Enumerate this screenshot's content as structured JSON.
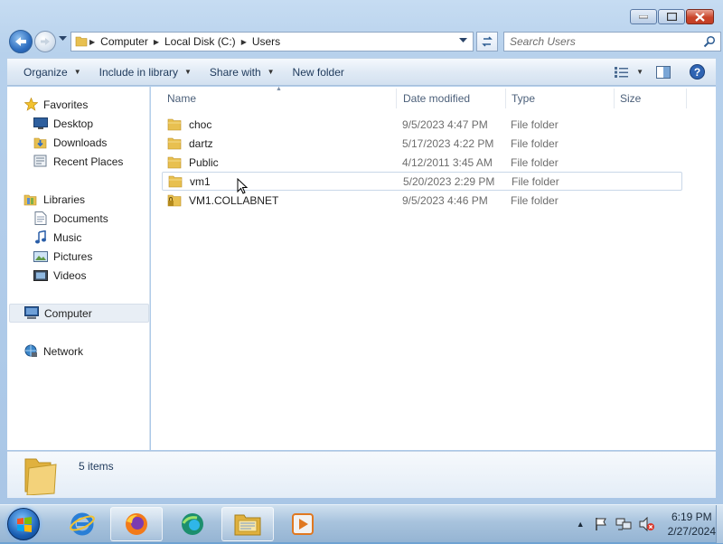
{
  "window": {
    "caption_buttons": [
      "minimize",
      "maximize",
      "close"
    ]
  },
  "address_bar": {
    "breadcrumbs": [
      "Computer",
      "Local Disk (C:)",
      "Users"
    ]
  },
  "search": {
    "placeholder": "Search Users"
  },
  "toolbar": {
    "organize": "Organize",
    "include_in_library": "Include in library",
    "share_with": "Share with",
    "new_folder": "New folder"
  },
  "nav": {
    "favorites": {
      "label": "Favorites",
      "items": [
        "Desktop",
        "Downloads",
        "Recent Places"
      ]
    },
    "libraries": {
      "label": "Libraries",
      "items": [
        "Documents",
        "Music",
        "Pictures",
        "Videos"
      ]
    },
    "computer": "Computer",
    "network": "Network"
  },
  "columns": {
    "name": "Name",
    "date": "Date modified",
    "type": "Type",
    "size": "Size"
  },
  "files": [
    {
      "name": "choc",
      "date": "9/5/2023 4:47 PM",
      "type": "File folder",
      "locked": false
    },
    {
      "name": "dartz",
      "date": "5/17/2023 4:22 PM",
      "type": "File folder",
      "locked": false
    },
    {
      "name": "Public",
      "date": "4/12/2011 3:45 AM",
      "type": "File folder",
      "locked": false
    },
    {
      "name": "vm1",
      "date": "5/20/2023 2:29 PM",
      "type": "File folder",
      "locked": false,
      "hovered": true
    },
    {
      "name": "VM1.COLLABNET",
      "date": "9/5/2023 4:46 PM",
      "type": "File folder",
      "locked": true
    }
  ],
  "details": {
    "item_count": "5 items"
  },
  "taskbar": {
    "apps": [
      "internet-explorer",
      "firefox",
      "edge",
      "windows-explorer",
      "media-player"
    ],
    "clock": {
      "time": "6:19 PM",
      "date": "2/27/2024"
    }
  },
  "colors": {
    "accent": "#1e395b",
    "folder": "#e8c050",
    "selection_border": "#c9d7e8"
  }
}
